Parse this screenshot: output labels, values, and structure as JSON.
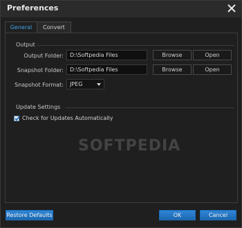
{
  "window": {
    "title": "Preferences"
  },
  "tabs": [
    {
      "label": "General",
      "active": true
    },
    {
      "label": "Convert",
      "active": false
    }
  ],
  "output": {
    "group_title": "Output",
    "output_folder": {
      "label": "Output Folder:",
      "value": "D:\\Softpedia Files",
      "browse": "Browse",
      "open": "Open"
    },
    "snapshot_folder": {
      "label": "Snapshot Folder:",
      "value": "D:\\Softpedia Files",
      "browse": "Browse",
      "open": "Open"
    },
    "snapshot_format": {
      "label": "Snapshot Format:",
      "value": "JPEG"
    }
  },
  "update": {
    "group_title": "Update Settings",
    "check_updates": {
      "label": "Check for Updates Automatically",
      "checked": true
    }
  },
  "watermark": "SOFTPEDIA",
  "footer": {
    "restore": "Restore Defaults",
    "ok": "OK",
    "cancel": "Cancel"
  },
  "colors": {
    "accent": "#3fa3e8",
    "button_blue": "#1f74c4",
    "background": "#1f1f1f"
  }
}
